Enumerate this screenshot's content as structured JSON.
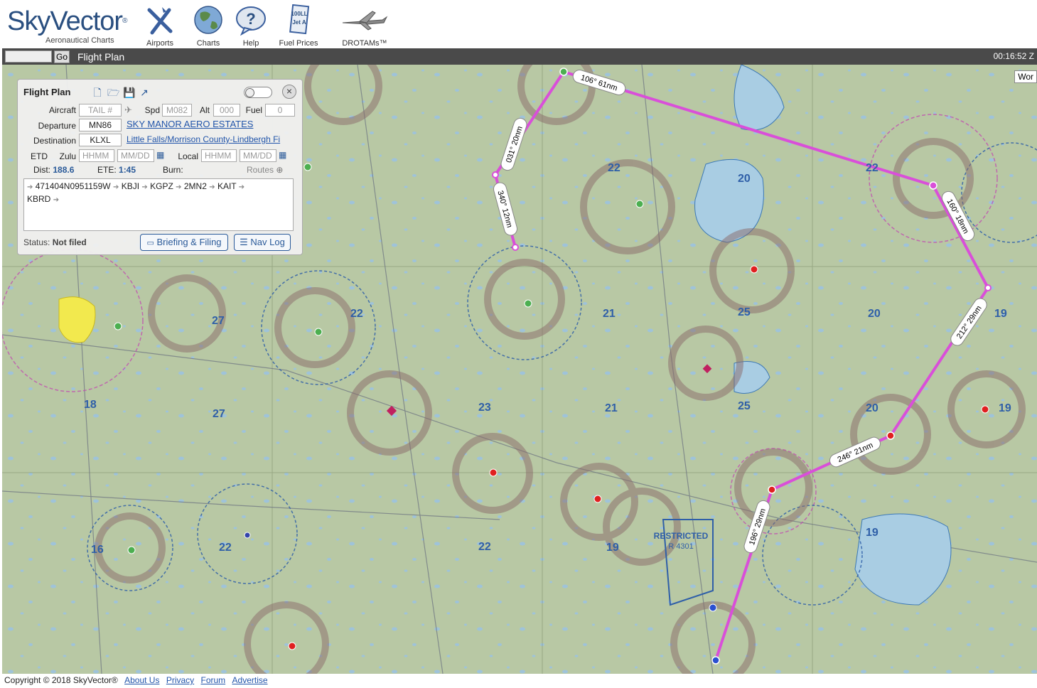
{
  "header": {
    "brand": "SkyVector",
    "tagline": "Aeronautical Charts",
    "nav": [
      {
        "label": "Airports",
        "icon": "airports-icon"
      },
      {
        "label": "Charts",
        "icon": "charts-globe-icon"
      },
      {
        "label": "Help",
        "icon": "help-icon"
      },
      {
        "label": "Fuel Prices",
        "icon": "fuel-prices-icon"
      },
      {
        "label": "DROTAMs™",
        "icon": "drone-icon"
      }
    ]
  },
  "topbar": {
    "go_label": "Go",
    "flight_plan_tab": "Flight Plan",
    "clock": "00:16:52 Z"
  },
  "map": {
    "world_button": "Wor",
    "restricted_label": "RESTRICTED",
    "restricted_id": "R 4301",
    "leg_labels": [
      "106° 61nm",
      "031° 20nm",
      "340° 12nm",
      "160° 18nm",
      "212° 29nm",
      "246° 21nm",
      "196° 29nm"
    ],
    "route_color": "#d94fd9"
  },
  "flight_plan": {
    "title": "Flight Plan",
    "aircraft_label": "Aircraft",
    "tail_placeholder": "TAIL #",
    "spd_label": "Spd",
    "spd_placeholder": "M082",
    "alt_label": "Alt",
    "alt_placeholder": "000",
    "fuel_label": "Fuel",
    "fuel_placeholder": "0",
    "departure_label": "Departure",
    "departure_value": "MN86",
    "departure_name": "SKY MANOR AERO ESTATES",
    "destination_label": "Destination",
    "destination_value": "KLXL",
    "destination_name": "Little Falls/Morrison County-Lindbergh Fi",
    "etd_label": "ETD",
    "zulu_label": "Zulu",
    "local_label": "Local",
    "time_placeholder": "HHMM",
    "date_placeholder": "MM/DD",
    "dist_label": "Dist:",
    "dist_value": "188.6",
    "ete_label": "ETE:",
    "ete_value": "1:45",
    "burn_label": "Burn:",
    "routes_label": "Routes",
    "route_waypoints": [
      "471404N0951159W",
      "KBJI",
      "KGPZ",
      "2MN2",
      "KAIT",
      "KBRD"
    ],
    "status_label": "Status:",
    "status_value": "Not filed",
    "briefing_button": "Briefing & Filing",
    "navlog_button": "Nav Log"
  },
  "footer": {
    "copyright": "Copyright © 2018 SkyVector®",
    "links": [
      "About Us",
      "Privacy",
      "Forum",
      "Advertise"
    ]
  }
}
